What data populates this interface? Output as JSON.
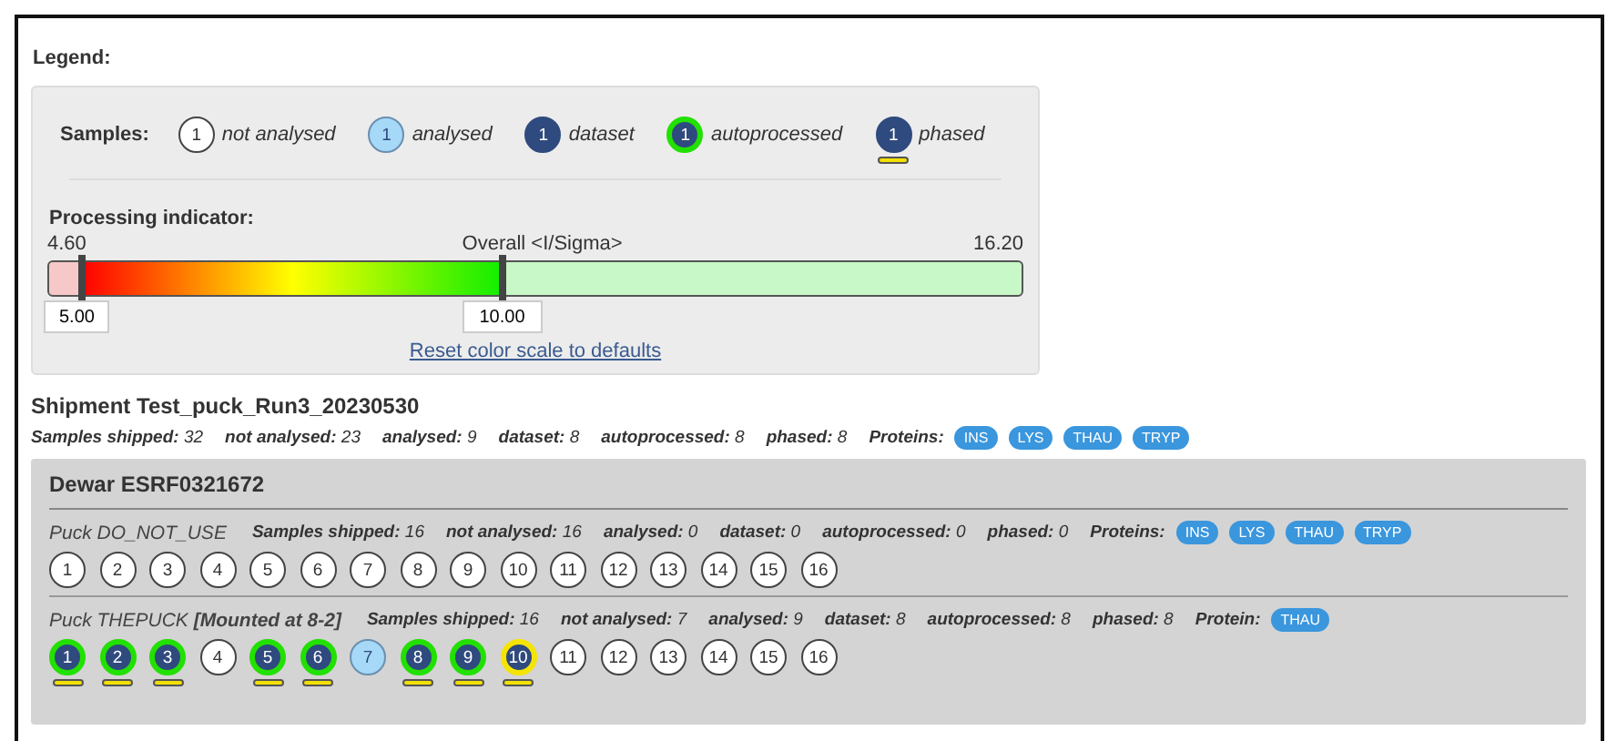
{
  "legend": {
    "title": "Legend:",
    "samples_label": "Samples:",
    "items": [
      {
        "number": "1",
        "kind": "not_analysed",
        "phased": false,
        "label": "not analysed"
      },
      {
        "number": "1",
        "kind": "analysed",
        "phased": false,
        "label": "analysed"
      },
      {
        "number": "1",
        "kind": "dataset",
        "phased": false,
        "label": "dataset"
      },
      {
        "number": "1",
        "kind": "autoprocessed",
        "color": "#22e000",
        "phased": false,
        "label": "autoprocessed"
      },
      {
        "number": "1",
        "kind": "dataset",
        "phased": true,
        "label": "phased"
      }
    ]
  },
  "processing": {
    "title": "Processing indicator:",
    "min": "4.60",
    "axis_label": "Overall <I/Sigma>",
    "max": "16.20",
    "low": {
      "value": "5.00",
      "level": 0.034
    },
    "high": {
      "value": "10.00",
      "level": 0.466
    },
    "reset_link": "Reset color scale to defaults"
  },
  "shipment": {
    "title": "Shipment Test_puck_Run3_20230530",
    "stats": [
      {
        "label": "Samples shipped:",
        "value": "32"
      },
      {
        "label": "not analysed:",
        "value": "23"
      },
      {
        "label": "analysed:",
        "value": "9"
      },
      {
        "label": "dataset:",
        "value": "8"
      },
      {
        "label": "autoprocessed:",
        "value": "8"
      },
      {
        "label": "phased:",
        "value": "8"
      }
    ],
    "proteins_label": "Proteins:",
    "proteins": [
      "INS",
      "LYS",
      "THAU",
      "TRYP"
    ]
  },
  "dewar": {
    "title": "Dewar ESRF0321672",
    "pucks": [
      {
        "name": "Puck DO_NOT_USE",
        "stats": [
          {
            "label": "Samples shipped:",
            "value": "16"
          },
          {
            "label": "not analysed:",
            "value": "16"
          },
          {
            "label": "analysed:",
            "value": "0"
          },
          {
            "label": "dataset:",
            "value": "0"
          },
          {
            "label": "autoprocessed:",
            "value": "0"
          },
          {
            "label": "phased:",
            "value": "0"
          }
        ],
        "proteins_label": "Proteins:",
        "proteins": [
          "INS",
          "LYS",
          "THAU",
          "TRYP"
        ],
        "samples": [
          {
            "number": "1",
            "kind": "not_analysed",
            "phased": false
          },
          {
            "number": "2",
            "kind": "not_analysed",
            "phased": false
          },
          {
            "number": "3",
            "kind": "not_analysed",
            "phased": false
          },
          {
            "number": "4",
            "kind": "not_analysed",
            "phased": false
          },
          {
            "number": "5",
            "kind": "not_analysed",
            "phased": false
          },
          {
            "number": "6",
            "kind": "not_analysed",
            "phased": false
          },
          {
            "number": "7",
            "kind": "not_analysed",
            "phased": false
          },
          {
            "number": "8",
            "kind": "not_analysed",
            "phased": false
          },
          {
            "number": "9",
            "kind": "not_analysed",
            "phased": false
          },
          {
            "number": "10",
            "kind": "not_analysed",
            "phased": false
          },
          {
            "number": "11",
            "kind": "not_analysed",
            "phased": false
          },
          {
            "number": "12",
            "kind": "not_analysed",
            "phased": false
          },
          {
            "number": "13",
            "kind": "not_analysed",
            "phased": false
          },
          {
            "number": "14",
            "kind": "not_analysed",
            "phased": false
          },
          {
            "number": "15",
            "kind": "not_analysed",
            "phased": false
          },
          {
            "number": "16",
            "kind": "not_analysed",
            "phased": false
          }
        ]
      },
      {
        "name": "Puck THEPUCK",
        "mounted": "[Mounted at 8-2]",
        "stats": [
          {
            "label": "Samples shipped:",
            "value": "16"
          },
          {
            "label": "not analysed:",
            "value": "7"
          },
          {
            "label": "analysed:",
            "value": "9"
          },
          {
            "label": "dataset:",
            "value": "8"
          },
          {
            "label": "autoprocessed:",
            "value": "8"
          },
          {
            "label": "phased:",
            "value": "8"
          }
        ],
        "proteins_label": "Protein:",
        "proteins": [
          "THAU"
        ],
        "samples": [
          {
            "number": "1",
            "kind": "autoprocessed",
            "color": "#22e000",
            "phased": true
          },
          {
            "number": "2",
            "kind": "autoprocessed",
            "color": "#22e000",
            "phased": true
          },
          {
            "number": "3",
            "kind": "autoprocessed",
            "color": "#22e000",
            "phased": true
          },
          {
            "number": "4",
            "kind": "not_analysed",
            "phased": false
          },
          {
            "number": "5",
            "kind": "autoprocessed",
            "color": "#22e000",
            "phased": true
          },
          {
            "number": "6",
            "kind": "autoprocessed",
            "color": "#22e000",
            "phased": true
          },
          {
            "number": "7",
            "kind": "analysed",
            "phased": false
          },
          {
            "number": "8",
            "kind": "autoprocessed",
            "color": "#22e000",
            "phased": true
          },
          {
            "number": "9",
            "kind": "autoprocessed",
            "color": "#22e000",
            "phased": true
          },
          {
            "number": "10",
            "kind": "autoprocessed",
            "color": "#f5e400",
            "phased": true
          },
          {
            "number": "11",
            "kind": "not_analysed",
            "phased": false
          },
          {
            "number": "12",
            "kind": "not_analysed",
            "phased": false
          },
          {
            "number": "13",
            "kind": "not_analysed",
            "phased": false
          },
          {
            "number": "14",
            "kind": "not_analysed",
            "phased": false
          },
          {
            "number": "15",
            "kind": "not_analysed",
            "phased": false
          },
          {
            "number": "16",
            "kind": "not_analysed",
            "phased": false
          }
        ]
      }
    ]
  }
}
